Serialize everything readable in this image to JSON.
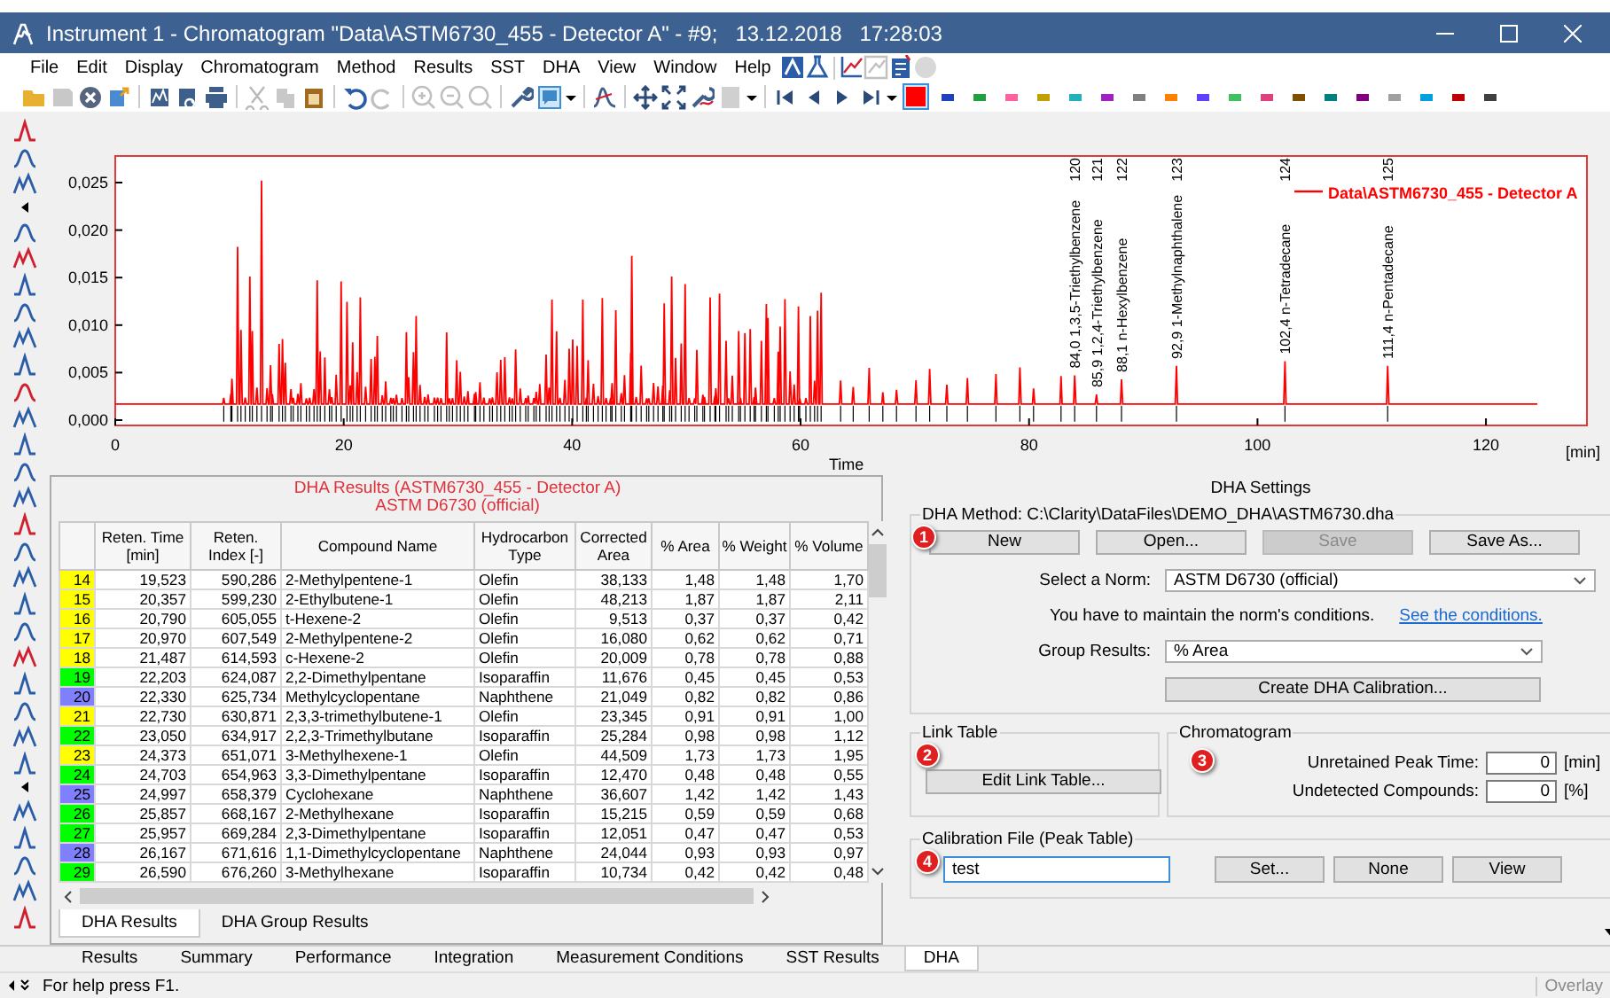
{
  "window": {
    "title": "Instrument 1 - Chromatogram \"Data\\ASTM6730_455 - Detector A\" - #9;   13.12.2018   17:28:03"
  },
  "menu": [
    "File",
    "Edit",
    "Display",
    "Chromatogram",
    "Method",
    "Results",
    "SST",
    "DHA",
    "View",
    "Window",
    "Help"
  ],
  "toolbar": {
    "colors": [
      {
        "color": "#ff0000",
        "selected": true
      },
      {
        "color": "#2040c0",
        "selected": false
      },
      {
        "color": "#20a040",
        "selected": false
      },
      {
        "color": "#ff60a0",
        "selected": false
      },
      {
        "color": "#c0a000",
        "selected": false
      },
      {
        "color": "#20b0c0",
        "selected": false
      },
      {
        "color": "#a020c0",
        "selected": false
      },
      {
        "color": "#808080",
        "selected": false
      },
      {
        "color": "#ff8000",
        "selected": false
      },
      {
        "color": "#6040ff",
        "selected": false
      },
      {
        "color": "#40c060",
        "selected": false
      },
      {
        "color": "#e04080",
        "selected": false
      },
      {
        "color": "#805000",
        "selected": false
      },
      {
        "color": "#008080",
        "selected": false
      },
      {
        "color": "#800080",
        "selected": false
      },
      {
        "color": "#a0a0a0",
        "selected": false
      },
      {
        "color": "#00a0e0",
        "selected": false
      },
      {
        "color": "#c00000",
        "selected": false
      },
      {
        "color": "#404040",
        "selected": false
      }
    ]
  },
  "chromatogram": {
    "legend": "Data\\ASTM6730_455 - Detector A",
    "y_ticks": [
      "0,025",
      "0,020",
      "0,015",
      "0,010",
      "0,005",
      "0,000"
    ],
    "x_ticks": [
      "0",
      "20",
      "40",
      "60",
      "80",
      "100",
      "120"
    ],
    "x_label": "Time",
    "x_unit": "[min]",
    "peak_labels": [
      {
        "number": "120",
        "label": "84,0 1,3,5-Triethylbenzene"
      },
      {
        "number": "121",
        "label": "85,9 1,2,4-Triethylbenzene"
      },
      {
        "number": "122",
        "label": "88,1 n-Hexylbenzene"
      },
      {
        "number": "123",
        "label": "92,9 1-Methylnaphthalene"
      },
      {
        "number": "124",
        "label": "102,4 n-Tetradecane"
      },
      {
        "number": "125",
        "label": "111,4 n-Pentadecane"
      }
    ]
  },
  "results_table": {
    "title": "DHA Results (ASTM6730_455 - Detector A)",
    "subtitle": "ASTM D6730 (official)",
    "columns": [
      "Reten. Time [min]",
      "Reten. Index [-]",
      "Compound Name",
      "Hydrocarbon Type",
      "Corrected Area",
      "% Area",
      "% Weight",
      "% Volume"
    ],
    "rows": [
      {
        "number": "14",
        "color": "#ffff00",
        "cells": [
          "19,523",
          "590,286",
          "2-Methylpentene-1",
          "Olefin",
          "38,133",
          "1,48",
          "1,48",
          "1,70"
        ]
      },
      {
        "number": "15",
        "color": "#ffff00",
        "cells": [
          "20,357",
          "599,230",
          "2-Ethylbutene-1",
          "Olefin",
          "48,213",
          "1,87",
          "1,87",
          "2,11"
        ]
      },
      {
        "number": "16",
        "color": "#ffff00",
        "cells": [
          "20,790",
          "605,055",
          "t-Hexene-2",
          "Olefin",
          "9,513",
          "0,37",
          "0,37",
          "0,42"
        ]
      },
      {
        "number": "17",
        "color": "#ffff00",
        "cells": [
          "20,970",
          "607,549",
          "2-Methylpentene-2",
          "Olefin",
          "16,080",
          "0,62",
          "0,62",
          "0,71"
        ]
      },
      {
        "number": "18",
        "color": "#ffff00",
        "cells": [
          "21,487",
          "614,593",
          "c-Hexene-2",
          "Olefin",
          "20,009",
          "0,78",
          "0,78",
          "0,88"
        ]
      },
      {
        "number": "19",
        "color": "#00ff00",
        "cells": [
          "22,203",
          "624,087",
          "2,2-Dimethylpentane",
          "Isoparaffin",
          "11,676",
          "0,45",
          "0,45",
          "0,53"
        ]
      },
      {
        "number": "20",
        "color": "#8080ff",
        "cells": [
          "22,330",
          "625,734",
          "Methylcyclopentane",
          "Naphthene",
          "21,049",
          "0,82",
          "0,82",
          "0,86"
        ]
      },
      {
        "number": "21",
        "color": "#ffff00",
        "cells": [
          "22,730",
          "630,871",
          "2,3,3-trimethylbutene-1",
          "Olefin",
          "23,345",
          "0,91",
          "0,91",
          "1,00"
        ]
      },
      {
        "number": "22",
        "color": "#00ff00",
        "cells": [
          "23,050",
          "634,917",
          "2,2,3-Trimethylbutane",
          "Isoparaffin",
          "25,284",
          "0,98",
          "0,98",
          "1,12"
        ]
      },
      {
        "number": "23",
        "color": "#ffff00",
        "cells": [
          "24,373",
          "651,071",
          "3-Methylhexene-1",
          "Olefin",
          "44,509",
          "1,73",
          "1,73",
          "1,95"
        ]
      },
      {
        "number": "24",
        "color": "#00ff00",
        "cells": [
          "24,703",
          "654,963",
          "3,3-Dimethylpentane",
          "Isoparaffin",
          "12,470",
          "0,48",
          "0,48",
          "0,55"
        ]
      },
      {
        "number": "25",
        "color": "#8080ff",
        "cells": [
          "24,997",
          "658,379",
          "Cyclohexane",
          "Naphthene",
          "36,607",
          "1,42",
          "1,42",
          "1,43"
        ]
      },
      {
        "number": "26",
        "color": "#00ff00",
        "cells": [
          "25,857",
          "668,167",
          "2-Methylhexane",
          "Isoparaffin",
          "15,215",
          "0,59",
          "0,59",
          "0,68"
        ]
      },
      {
        "number": "27",
        "color": "#00ff00",
        "cells": [
          "25,957",
          "669,284",
          "2,3-Dimethylpentane",
          "Isoparaffin",
          "12,051",
          "0,47",
          "0,47",
          "0,53"
        ]
      },
      {
        "number": "28",
        "color": "#8080ff",
        "cells": [
          "26,167",
          "671,616",
          "1,1-Dimethylcyclopentane",
          "Naphthene",
          "24,044",
          "0,93",
          "0,93",
          "0,97"
        ]
      },
      {
        "number": "29",
        "color": "#00ff00",
        "cells": [
          "26,590",
          "676,260",
          "3-Methylhexane",
          "Isoparaffin",
          "10,734",
          "0,42",
          "0,42",
          "0,48"
        ]
      }
    ],
    "tabs": [
      {
        "label": "DHA Results",
        "selected": true
      },
      {
        "label": "DHA Group Results",
        "selected": false
      }
    ]
  },
  "dha_settings": {
    "title": "DHA Settings",
    "method": "DHA Method: C:\\Clarity\\DataFiles\\DEMO_DHA\\ASTM6730.dha",
    "marker": "1",
    "buttons": [
      {
        "label": "New",
        "disabled": false
      },
      {
        "label": "Open...",
        "disabled": false
      },
      {
        "label": "Save",
        "disabled": true
      },
      {
        "label": "Save As...",
        "disabled": false
      }
    ],
    "norm": {
      "label": "Select a Norm:",
      "value": "ASTM D6730 (official)"
    },
    "note": "You have to maintain the norm's conditions.",
    "link": "See the conditions.",
    "group_results": {
      "label": "Group Results:",
      "value": "% Area"
    },
    "calibration_button": "Create DHA Calibration...",
    "link_table": {
      "title": "Link Table",
      "marker": "2",
      "button": "Edit Link Table..."
    },
    "chromatogram": {
      "title": "Chromatogram",
      "marker": "3",
      "fields": [
        {
          "label": "Unretained Peak Time:",
          "value": "0",
          "unit": "[min]"
        },
        {
          "label": "Undetected Compounds:",
          "value": "0",
          "unit": "[%]"
        }
      ]
    },
    "calibration_file": {
      "title": "Calibration File (Peak Table)",
      "marker": "4",
      "value": "test",
      "buttons": [
        "Set...",
        "None",
        "View"
      ]
    }
  },
  "bottom_tabs": [
    {
      "label": "Results",
      "selected": false
    },
    {
      "label": "Summary",
      "selected": false
    },
    {
      "label": "Performance",
      "selected": false
    },
    {
      "label": "Integration",
      "selected": false
    },
    {
      "label": "Measurement Conditions",
      "selected": false
    },
    {
      "label": "SST Results",
      "selected": false
    },
    {
      "label": "DHA",
      "selected": true
    }
  ],
  "status_bar": {
    "text": "For help press F1.",
    "mode": "Overlay"
  }
}
